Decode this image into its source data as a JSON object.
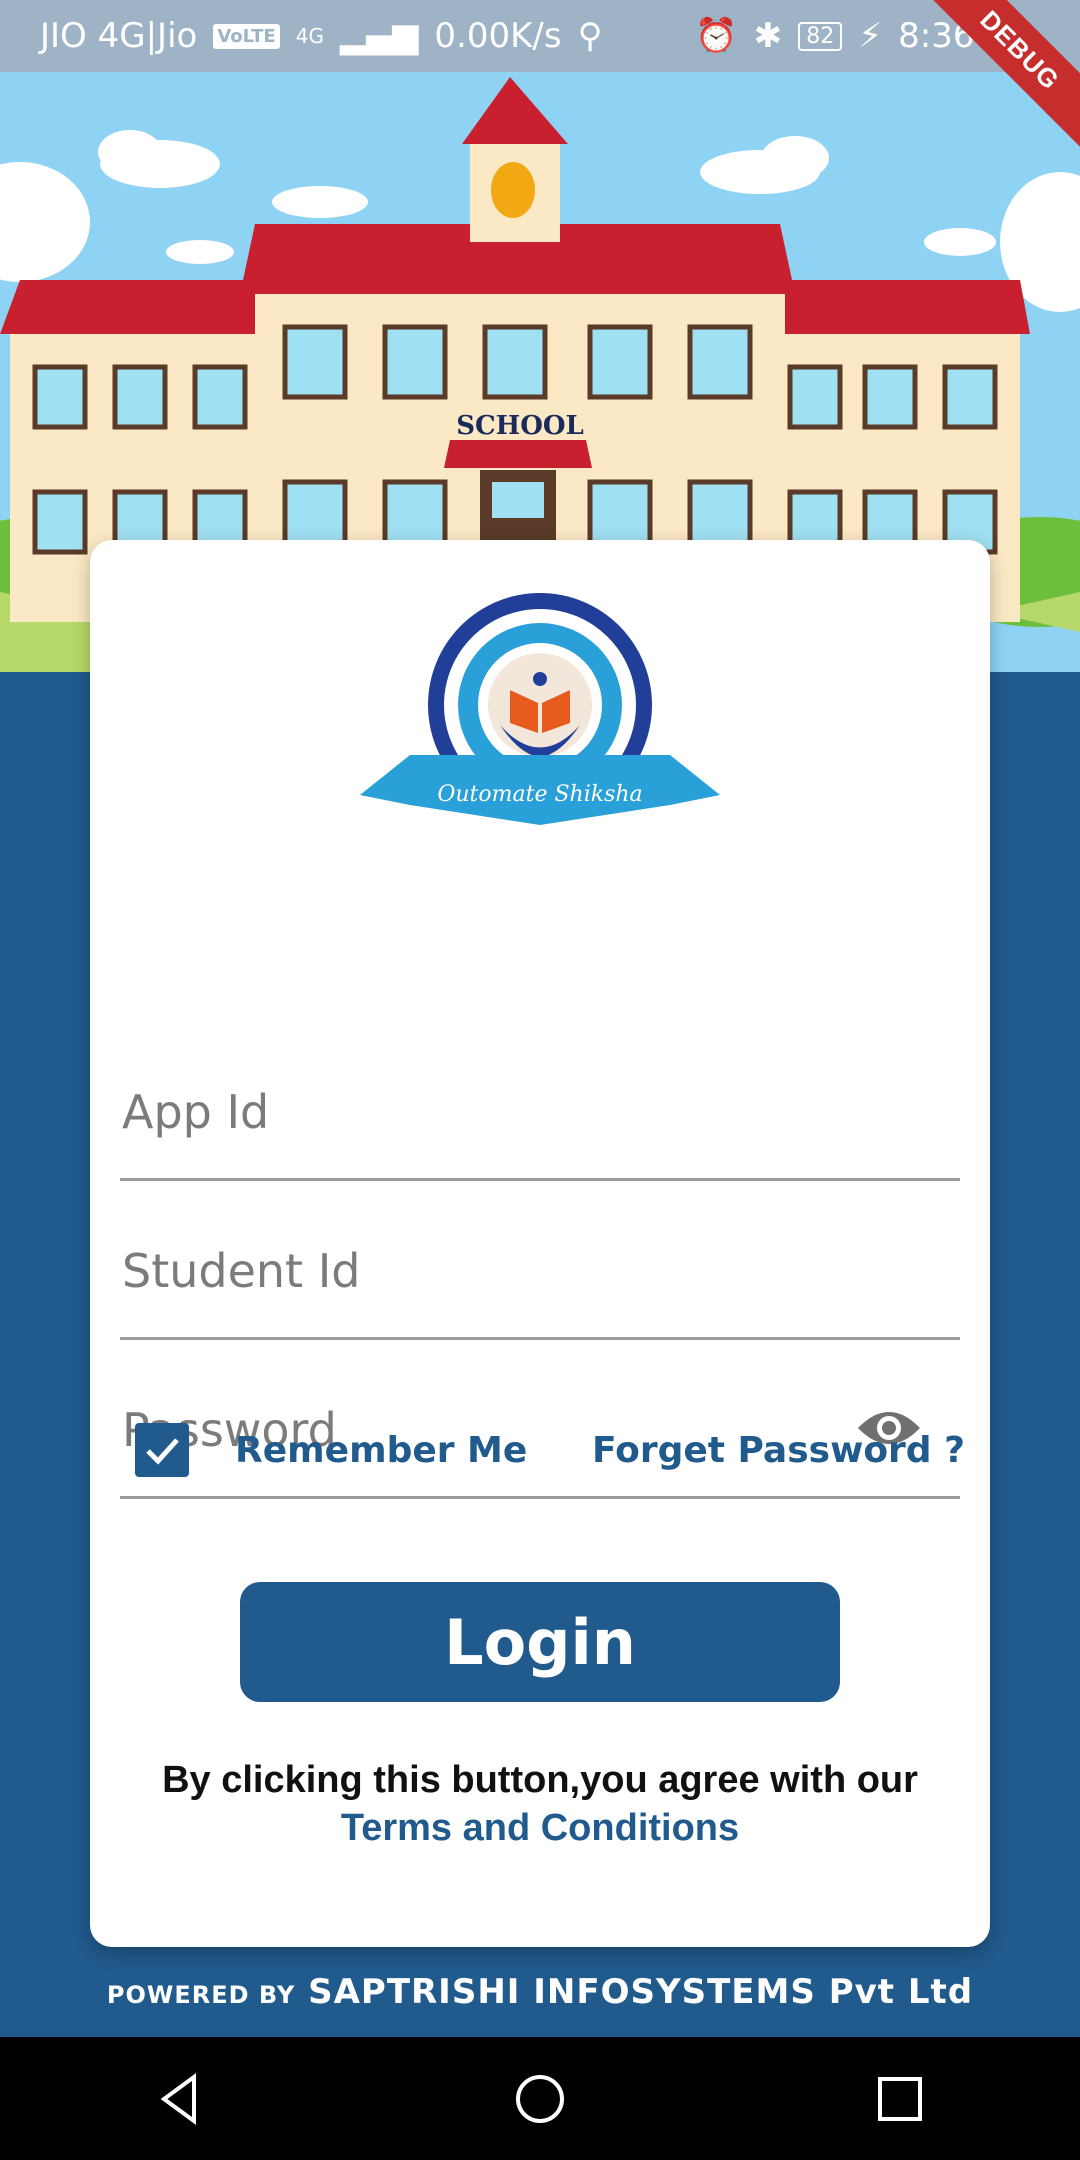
{
  "status_bar": {
    "carrier": "JIO 4G|Jio",
    "volte": "VoLTE",
    "network": "4G",
    "speed": "0.00K/s",
    "battery": "82",
    "time": "8:36 pm"
  },
  "debug_banner": "DEBUG",
  "scene": {
    "school_sign": "SCHOOL"
  },
  "logo": {
    "name": "Outomate Shiksha"
  },
  "form": {
    "app_id_placeholder": "App Id",
    "student_id_placeholder": "Student Id",
    "password_placeholder": "Password",
    "remember_me": "Remember Me",
    "remember_checked": true,
    "forgot_password": "Forget Password ?",
    "login_label": "Login",
    "terms_prefix": "By clicking this button,you agree with our",
    "terms_link": "Terms and Conditions"
  },
  "footer": {
    "powered_by": "POWERED BY",
    "company": "SAPTRISHI INFOSYSTEMS",
    "suffix": "Pvt Ltd"
  },
  "colors": {
    "primary": "#215a8c",
    "roof": "#c8202e",
    "sky": "#8fd3f4"
  }
}
